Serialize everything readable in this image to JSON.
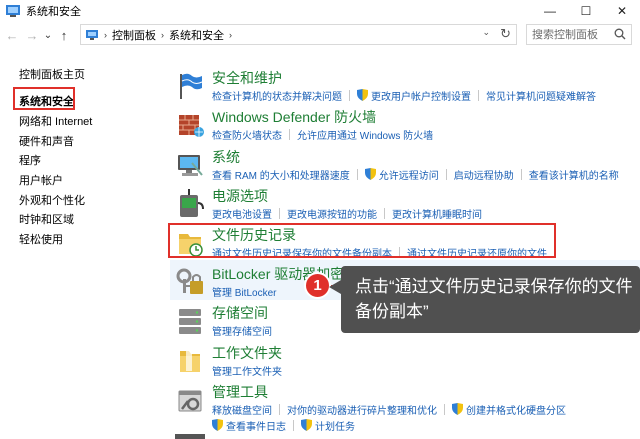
{
  "window": {
    "title": "系统和安全",
    "minimize": "—",
    "maximize": "☐",
    "close": "✕"
  },
  "nav": {
    "back": "←",
    "forward": "→",
    "recent": "⌄",
    "up": "↑",
    "breadcrumbs": [
      "控制面板",
      "系统和安全"
    ],
    "search_placeholder": "搜索控制面板"
  },
  "sidebar": {
    "items": [
      {
        "label": "控制面板主页",
        "active": false
      },
      {
        "label": "系统和安全",
        "active": true
      },
      {
        "label": "网络和 Internet",
        "active": false
      },
      {
        "label": "硬件和声音",
        "active": false
      },
      {
        "label": "程序",
        "active": false
      },
      {
        "label": "用户帐户",
        "active": false
      },
      {
        "label": "外观和个性化",
        "active": false
      },
      {
        "label": "时钟和区域",
        "active": false
      },
      {
        "label": "轻松使用",
        "active": false
      }
    ]
  },
  "categories": [
    {
      "title": "安全和维护",
      "icon": "flag-icon",
      "links": [
        {
          "text": "检查计算机的状态并解决问题",
          "shield": false
        },
        {
          "text": "更改用户帐户控制设置",
          "shield": true
        },
        {
          "text": "常见计算机问题疑难解答",
          "shield": false
        }
      ]
    },
    {
      "title": "Windows Defender 防火墙",
      "icon": "firewall-icon",
      "links": [
        {
          "text": "检查防火墙状态",
          "shield": false
        },
        {
          "text": "允许应用通过 Windows 防火墙",
          "shield": false
        }
      ]
    },
    {
      "title": "系统",
      "icon": "computer-icon",
      "links": [
        {
          "text": "查看 RAM 的大小和处理器速度",
          "shield": false
        },
        {
          "text": "允许远程访问",
          "shield": true
        },
        {
          "text": "启动远程协助",
          "shield": false
        },
        {
          "text": "查看该计算机的名称",
          "shield": false
        }
      ]
    },
    {
      "title": "电源选项",
      "icon": "power-icon",
      "links": [
        {
          "text": "更改电池设置",
          "shield": false
        },
        {
          "text": "更改电源按钮的功能",
          "shield": false
        },
        {
          "text": "更改计算机睡眠时间",
          "shield": false
        }
      ]
    },
    {
      "title": "文件历史记录",
      "icon": "file-history-icon",
      "links": [
        {
          "text": "通过文件历史记录保存你的文件备份副本",
          "shield": false
        },
        {
          "text": "通过文件历史记录还原你的文件",
          "shield": false
        }
      ]
    },
    {
      "title": "BitLocker 驱动器加密",
      "icon": "bitlocker-icon",
      "links": [
        {
          "text": "管理 BitLocker",
          "shield": false
        }
      ]
    },
    {
      "title": "存储空间",
      "icon": "storage-icon",
      "links": [
        {
          "text": "管理存储空间",
          "shield": false
        }
      ]
    },
    {
      "title": "工作文件夹",
      "icon": "folder-icon",
      "links": [
        {
          "text": "管理工作文件夹",
          "shield": false
        }
      ]
    },
    {
      "title": "管理工具",
      "icon": "admin-tools-icon",
      "links": [
        {
          "text": "释放磁盘空间",
          "shield": false
        },
        {
          "text": "对你的驱动器进行碎片整理和优化",
          "shield": false
        },
        {
          "text": "创建并格式化硬盘分区",
          "shield": true
        }
      ]
    },
    {
      "title": "",
      "icon": "",
      "links": [
        {
          "text": "查看事件日志",
          "shield": true
        },
        {
          "text": "计划任务",
          "shield": true
        }
      ]
    }
  ],
  "callout": {
    "step": "1",
    "text": "点击“通过文件历史记录保存你的文件备份副本”"
  },
  "colors": {
    "title_green": "#1e7e34",
    "link_blue": "#1a5fb4",
    "highlight_red": "#e0302a",
    "callout_bg": "#505050"
  }
}
